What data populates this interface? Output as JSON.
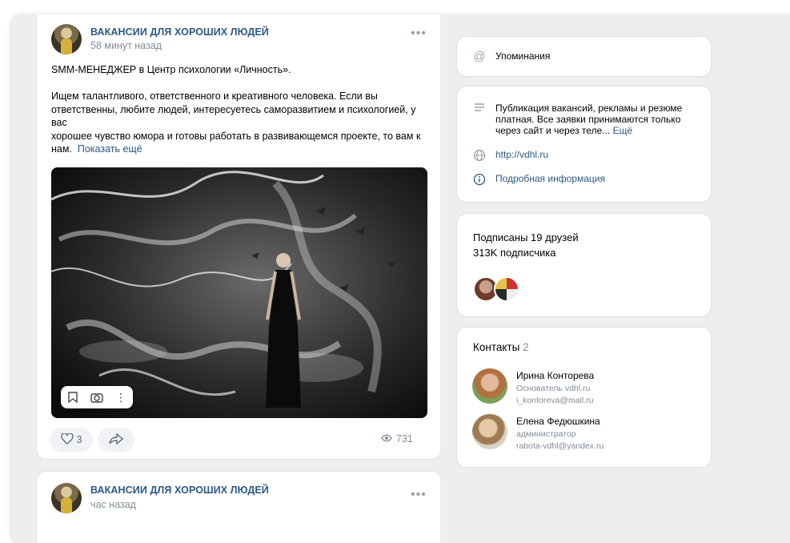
{
  "post1": {
    "author": "ВАКАНСИИ ДЛЯ ХОРОШИХ ЛЮДЕЙ",
    "time": "58 минут назад",
    "more_icon": "dots-icon",
    "title_line": "SMM-МЕНЕДЖЕР в Центр психологии «Личность».",
    "body_lines": [
      "Ищем талантливого, ответственного и креативного человека. Если вы",
      "ответственны, любите людей, интересуетесь саморазвитием и психологией, у вас",
      "хорошее чувство юмора и готовы работать в развивающемся проекте, то вам к",
      "нам."
    ],
    "show_more": "Показать ещё",
    "likes": "3",
    "views": "731"
  },
  "post2": {
    "author": "ВАКАНСИИ ДЛЯ ХОРОШИХ ЛЮДЕЙ",
    "time": "час назад"
  },
  "sidebar": {
    "mentions": "Упоминания",
    "about_text_lines": [
      "Публикация вакансий, рекламы и резюме",
      "платная. Все заявки принимаются только",
      "через сайт и через теле..."
    ],
    "about_more": "Ещё",
    "website": "http://vdhl.ru",
    "details": "Подробная информация",
    "friends_line": "Подписаны 19 друзей",
    "followers_line": "313K подписчика",
    "contacts_title": "Контакты",
    "contacts_count": "2",
    "contacts": [
      {
        "name": "Ирина Конторева",
        "role": "Основатель vdhl.ru",
        "email": "i_kontoreva@mail.ru"
      },
      {
        "name": "Елена Федюшкина",
        "role": "администратор",
        "email": "rabota-vdhl@yandex.ru"
      }
    ]
  },
  "colors": {
    "link": "#2a5885",
    "background": "#edeef0",
    "muted": "#818c99"
  }
}
